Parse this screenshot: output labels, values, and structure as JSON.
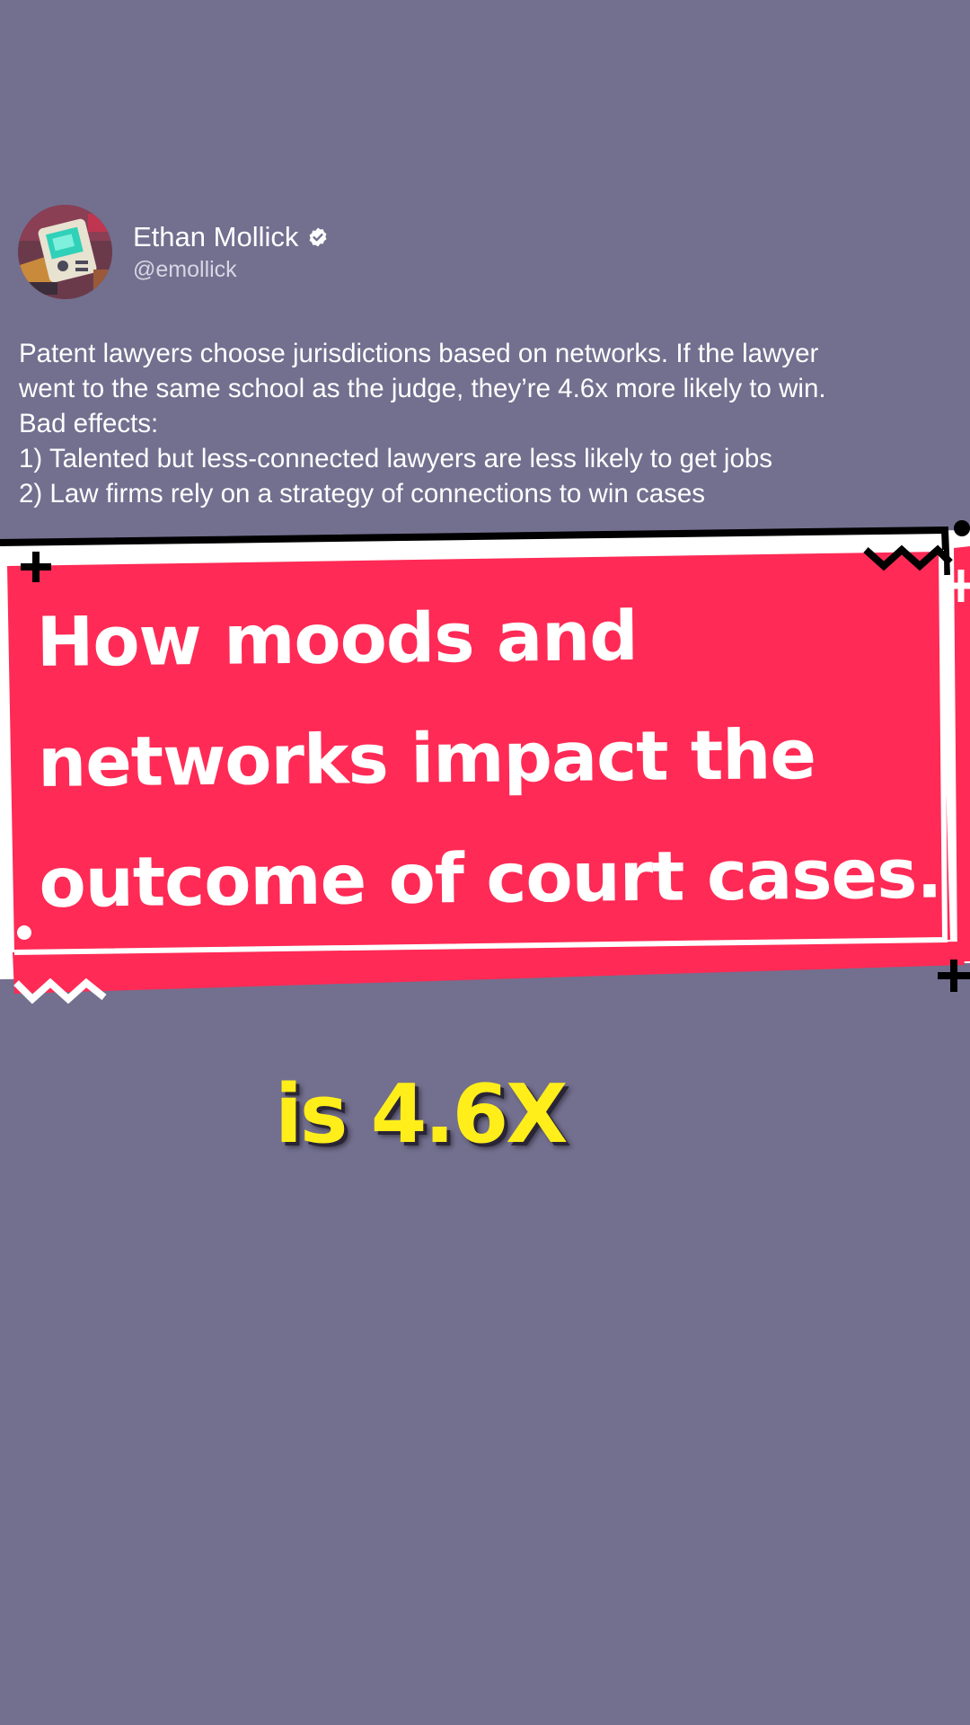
{
  "tweet": {
    "author_name": "Ethan Mollick",
    "handle": "@emollick",
    "avatar_icon": "pixel-art-device-avatar",
    "verified_icon": "verified-check-icon",
    "body_lines": [
      "Patent lawyers choose jurisdictions based on networks. If the lawyer",
      "went to the same school as the judge, they’re 4.6x more likely to win.",
      "Bad effects:",
      "1) Talented but less-connected lawyers are less likely to get jobs",
      "2) Law firms rely on a strategy of connections to win cases"
    ]
  },
  "headline": {
    "lines": [
      "How moods and",
      "networks impact the",
      "outcome of court cases."
    ]
  },
  "caption": {
    "text": "is 4.6X"
  },
  "colors": {
    "background": "#736f8f",
    "banner_red": "#ff2a55",
    "caption_yellow": "#ffee1a",
    "text_white": "#ffffff"
  }
}
